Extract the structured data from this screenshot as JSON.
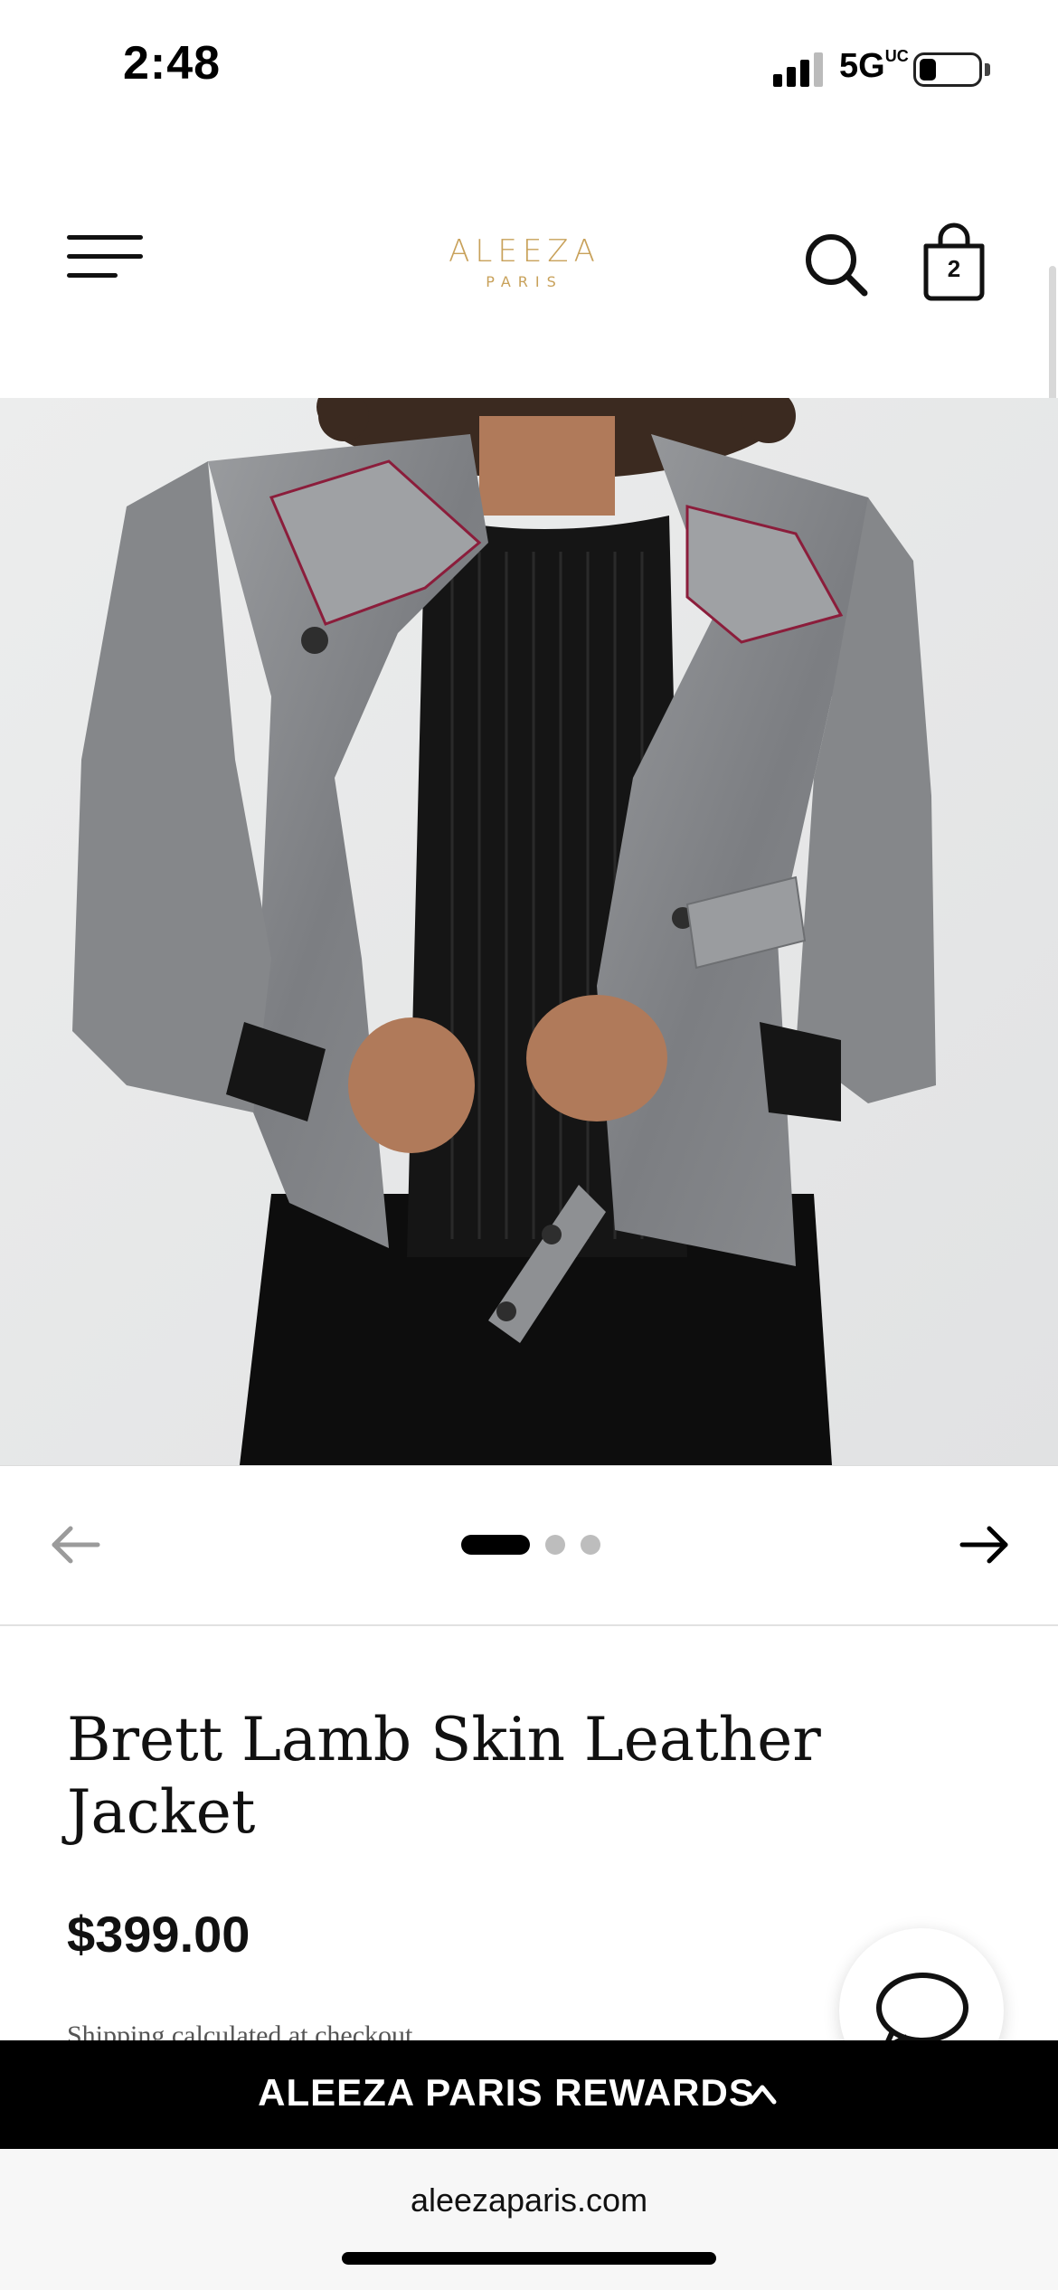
{
  "status_bar": {
    "time": "2:48",
    "network": "5G",
    "network_superscript": "UC"
  },
  "header": {
    "logo_main": "ALEEZA",
    "logo_sub": "PARIS",
    "cart_count": "2",
    "icons": [
      "menu-icon",
      "search-icon",
      "shopping-bag-icon"
    ],
    "logo_color": "#c8a15a"
  },
  "product": {
    "image_alt": "Model wearing grey distressed leather moto jacket over black knit top",
    "title": "Brett Lamb Skin Leather Jacket",
    "price": "$399.00",
    "shipping_note": "Shipping calculated at checkout",
    "carousel": {
      "total_images": 3,
      "active_index": 0
    }
  },
  "rewards": {
    "label": "ALEEZA PARIS REWARDS"
  },
  "browser": {
    "url": "aleezaparis.com"
  },
  "colors": {
    "jacket": "#8a8c8f",
    "background_photo": "#e9eaeb",
    "rewards_bar": "#000000"
  }
}
